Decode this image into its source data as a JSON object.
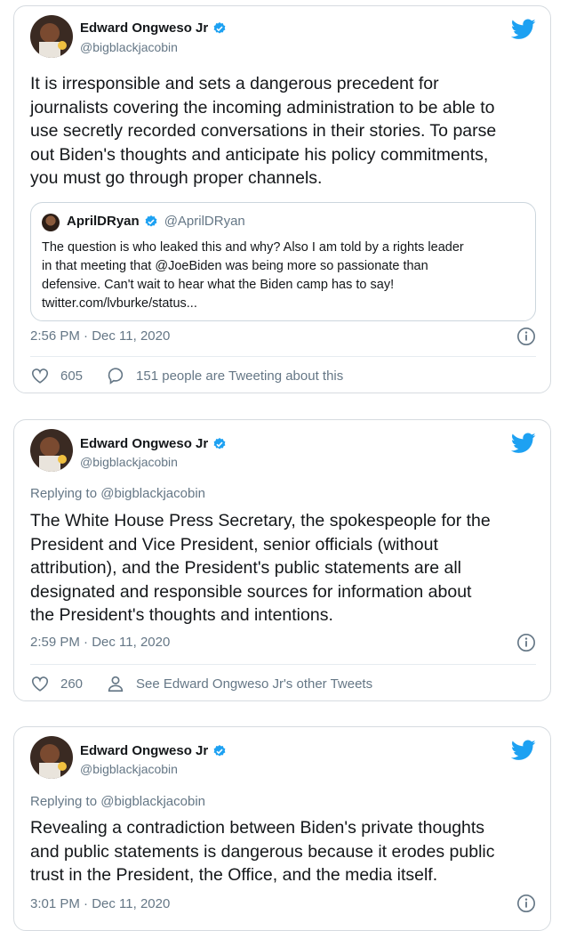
{
  "colors": {
    "accent": "#1da1f2",
    "text": "#14171a",
    "muted": "#657786",
    "border": "#d6dbe0"
  },
  "tweets": [
    {
      "author": {
        "name": "Edward Ongweso Jr",
        "handle": "@bigblackjacobin",
        "verified": true
      },
      "text": "It is irresponsible and sets a dangerous precedent for\njournalists covering the incoming administration to be able to\nuse secretly recorded conversations in their stories. To parse\nout Biden's thoughts and anticipate his policy commitments,\nyou must go through proper channels.",
      "quoted": {
        "name": "AprilDRyan",
        "handle": "@AprilDRyan",
        "verified": true,
        "text": "The question is who leaked this and why? Also I am told by a rights leader\nin that meeting that @JoeBiden was being more so passionate than\ndefensive.  Can't wait to hear what the Biden camp has to say!\ntwitter.com/lvburke/status..."
      },
      "timestamp": "2:56 PM · Dec 11, 2020",
      "likes": "605",
      "secondary_action": "151 people are Tweeting about this",
      "secondary_icon": "reply-bubble-icon"
    },
    {
      "author": {
        "name": "Edward Ongweso Jr",
        "handle": "@bigblackjacobin",
        "verified": true
      },
      "replying_to": "Replying to @bigblackjacobin",
      "text": "The White House Press Secretary, the spokespeople for the\nPresident and Vice President, senior officials (without\nattribution), and the President's public statements are all\ndesignated and responsible sources for information about\nthe President's thoughts and intentions.",
      "timestamp": "2:59 PM · Dec 11, 2020",
      "likes": "260",
      "secondary_action": "See Edward Ongweso Jr's other Tweets",
      "secondary_icon": "person-icon"
    },
    {
      "author": {
        "name": "Edward Ongweso Jr",
        "handle": "@bigblackjacobin",
        "verified": true
      },
      "replying_to": "Replying to @bigblackjacobin",
      "text": "Revealing a contradiction between Biden's private thoughts\nand public statements is dangerous because it erodes public\ntrust in the President, the Office, and the media itself.",
      "timestamp": "3:01 PM · Dec 11, 2020"
    }
  ]
}
